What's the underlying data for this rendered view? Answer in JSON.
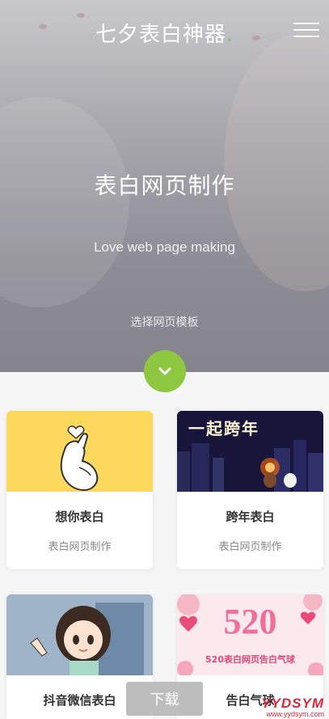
{
  "header": {
    "brand": "七夕表白神器",
    "brand_dot": ".",
    "menu_icon": "hamburger-menu-icon"
  },
  "hero": {
    "title": "表白网页制作",
    "subtitle": "Love web page making",
    "link": "选择网页模板",
    "down_icon": "chevron-down-icon"
  },
  "cards": [
    {
      "title": "想你表白",
      "desc": "表白网页制作",
      "thumb_text": ""
    },
    {
      "title": "跨年表白",
      "desc": "表白网页制作",
      "thumb_text": "一起跨年"
    },
    {
      "title": "抖音微信表白",
      "desc": "",
      "thumb_text": ""
    },
    {
      "title": "告白气球",
      "desc": "",
      "thumb_text": "520",
      "thumb_caption": "520表白网页告白气球"
    }
  ],
  "download_label": "下载",
  "watermark": {
    "line1": "YYDSYM",
    "line2": "www.yydsym.com"
  },
  "colors": {
    "accent": "#8dc63f",
    "heart_bg": "#fcd95c",
    "night_bg": "#17163a",
    "pink": "#e96a8f"
  }
}
